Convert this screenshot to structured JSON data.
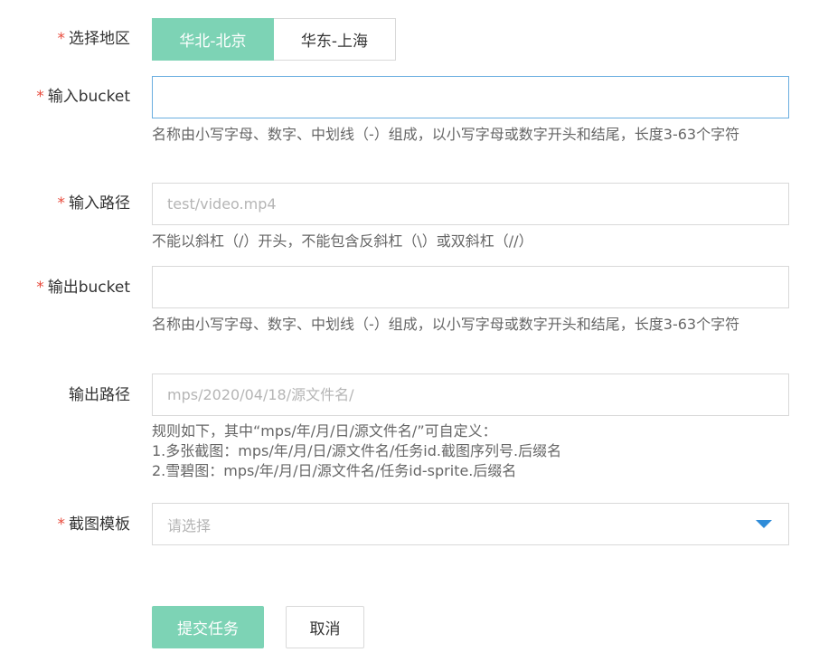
{
  "form": {
    "region": {
      "required_mark": "*",
      "label": "选择地区",
      "options": [
        "华北-北京",
        "华东-上海"
      ],
      "selected": "华北-北京"
    },
    "input_bucket": {
      "required_mark": "*",
      "label": "输入bucket",
      "value": "",
      "placeholder": "",
      "hint": "名称由小写字母、数字、中划线（-）组成，以小写字母或数字开头和结尾，长度3-63个字符"
    },
    "input_path": {
      "required_mark": "*",
      "label": "输入路径",
      "value": "",
      "placeholder": "test/video.mp4",
      "hint": "不能以斜杠（/）开头，不能包含反斜杠（\\）或双斜杠（//）"
    },
    "output_bucket": {
      "required_mark": "*",
      "label": "输出bucket",
      "value": "",
      "placeholder": "",
      "hint": "名称由小写字母、数字、中划线（-）组成，以小写字母或数字开头和结尾，长度3-63个字符"
    },
    "output_path": {
      "label": "输出路径",
      "value": "",
      "placeholder": "mps/2020/04/18/源文件名/",
      "hint_lines": [
        "规则如下，其中“mps/年/月/日/源文件名/”可自定义：",
        "1.多张截图：mps/年/月/日/源文件名/任务id.截图序列号.后缀名",
        "2.雪碧图：mps/年/月/日/源文件名/任务id-sprite.后缀名"
      ]
    },
    "snapshot_template": {
      "required_mark": "*",
      "label": "截图模板",
      "placeholder": "请选择",
      "icon": "caret-down-icon"
    }
  },
  "actions": {
    "submit_label": "提交任务",
    "cancel_label": "取消"
  },
  "colors": {
    "accent": "#7dd3b5",
    "required": "#e84a3c",
    "focus_border": "#6aaee0",
    "caret": "#2f8cd8"
  }
}
